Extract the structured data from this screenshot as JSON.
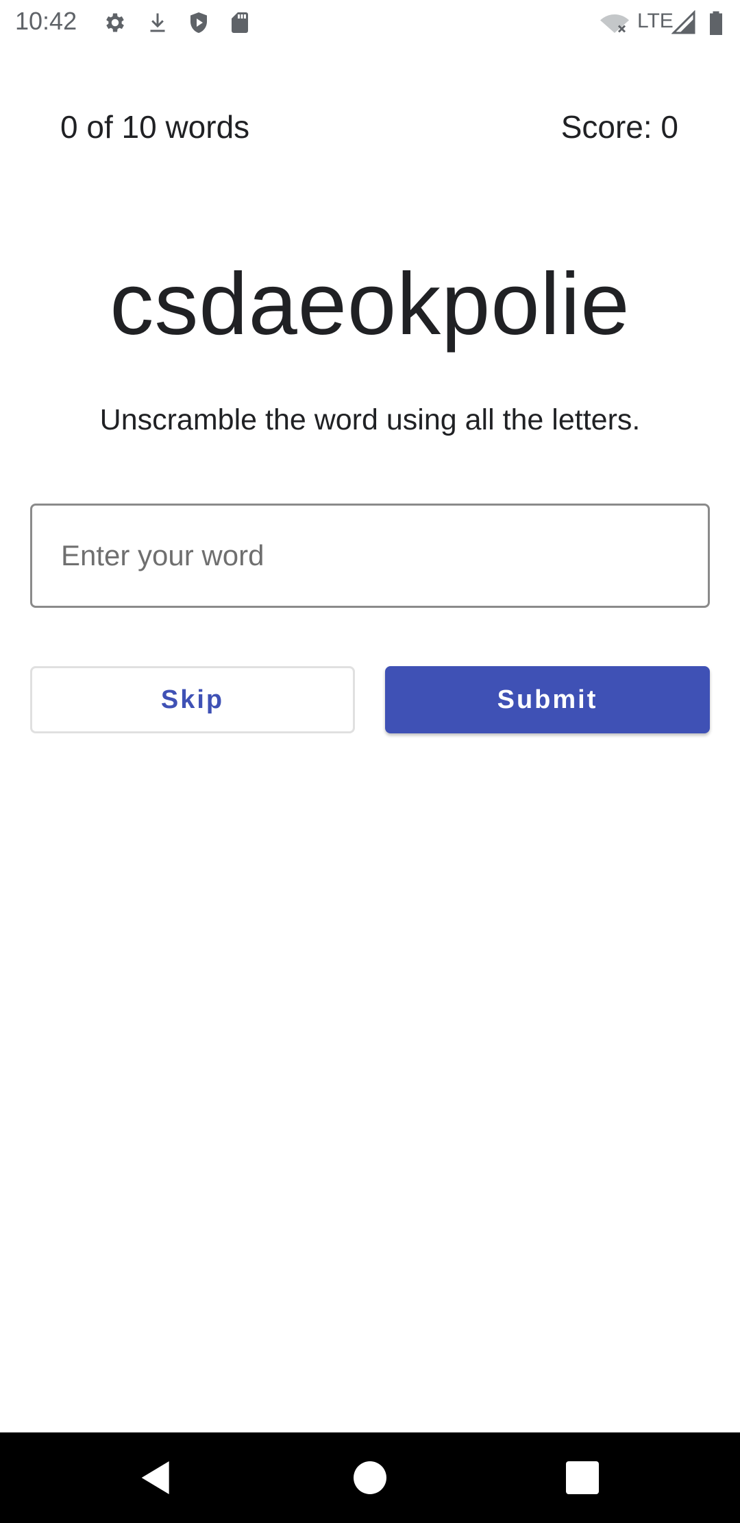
{
  "status_bar": {
    "time": "10:42",
    "network": "LTE",
    "icons": [
      "settings-icon",
      "download-icon",
      "shield-play-icon",
      "sd-card-icon",
      "wifi-off-icon",
      "signal-icon",
      "battery-icon"
    ]
  },
  "game": {
    "progress": "0 of 10 words",
    "score": "Score: 0",
    "scrambled_word": "csdaeokpolie",
    "instructions": "Unscramble the word using all the letters.",
    "input_placeholder": "Enter your word",
    "input_value": ""
  },
  "buttons": {
    "skip": "Skip",
    "submit": "Submit"
  },
  "colors": {
    "accent": "#3f51b5",
    "text": "#202124",
    "nav_bar": "#000000"
  },
  "nav": {
    "icons": [
      "back-icon",
      "home-icon",
      "recents-icon"
    ]
  }
}
